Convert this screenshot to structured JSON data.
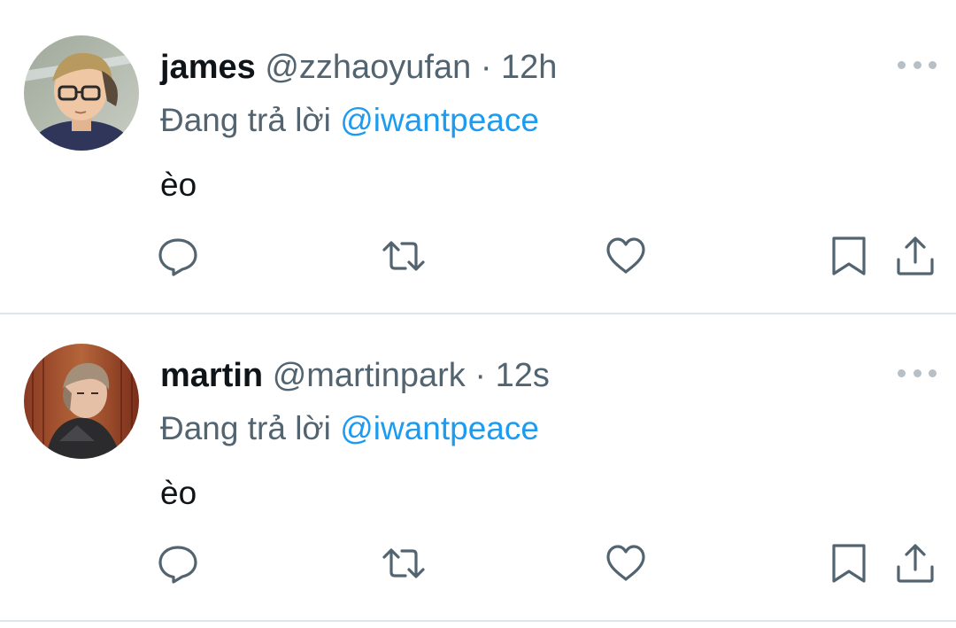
{
  "tweets": [
    {
      "display_name": "james",
      "handle": "@zzhaoyufan",
      "separator": "·",
      "time": "12h",
      "reply_prefix": "Đang trả lời",
      "reply_mention": "@iwantpeace",
      "text": "èo"
    },
    {
      "display_name": "martin",
      "handle": "@martinpark",
      "separator": "·",
      "time": "12s",
      "reply_prefix": "Đang trả lời",
      "reply_mention": "@iwantpeace",
      "text": "èo"
    }
  ],
  "colors": {
    "text_primary": "#0f1419",
    "text_secondary": "#536471",
    "mention": "#1d9bf0",
    "divider": "#dfe4e8"
  },
  "icons": [
    "reply-icon",
    "retweet-icon",
    "like-icon",
    "bookmark-icon",
    "share-icon",
    "more-icon"
  ]
}
